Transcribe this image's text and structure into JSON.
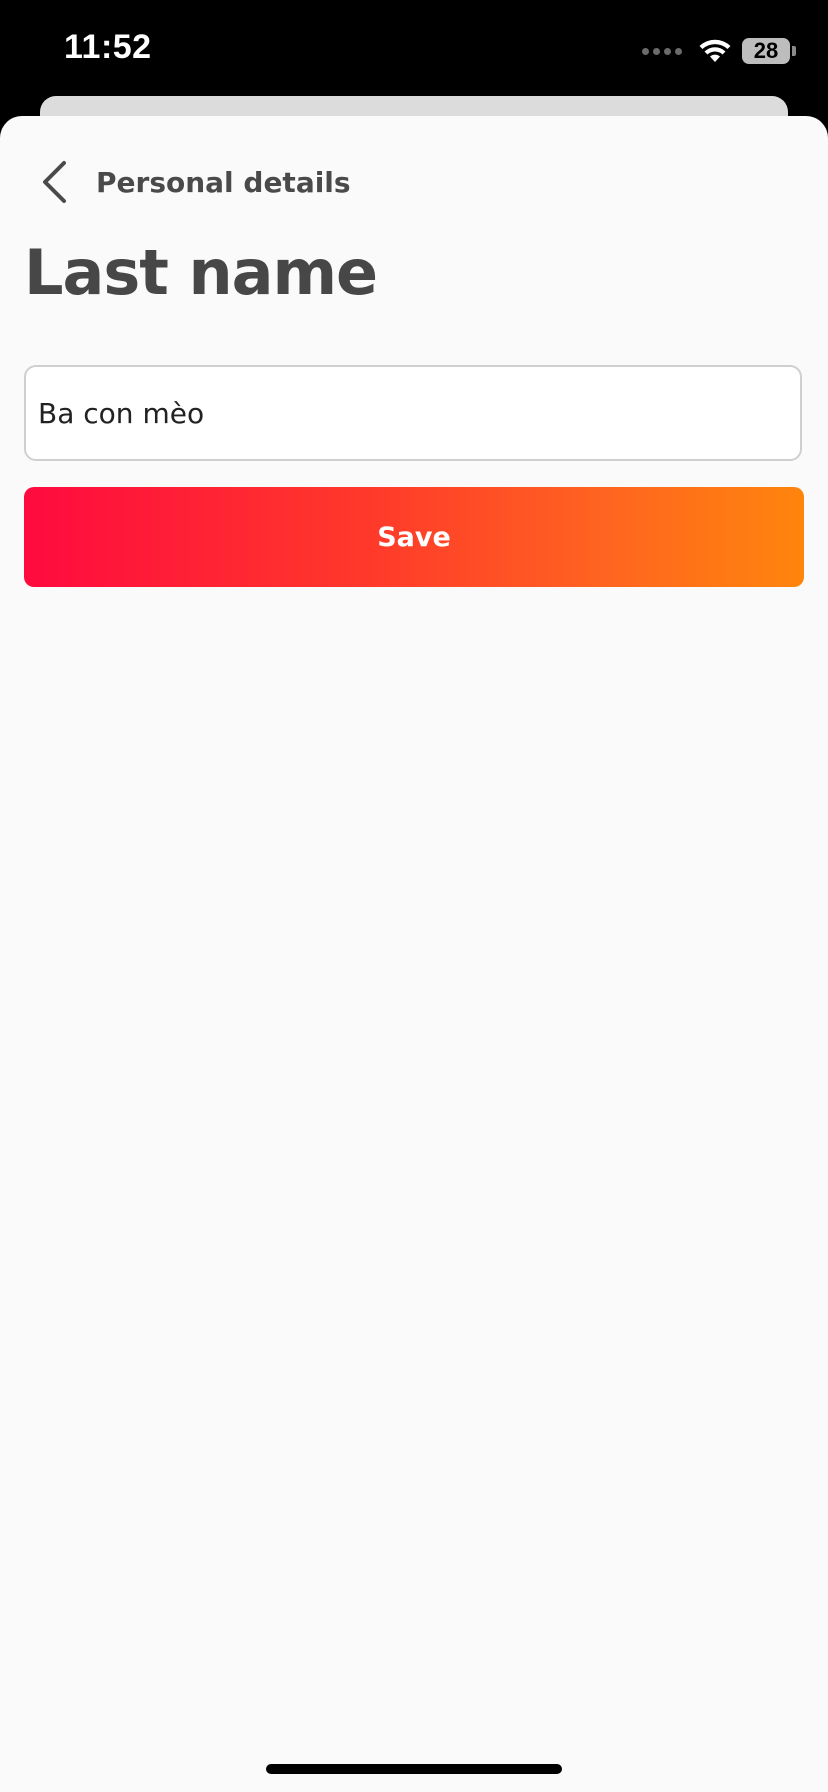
{
  "status_bar": {
    "time": "11:52",
    "battery_level": "28"
  },
  "nav": {
    "back_label": "Personal details"
  },
  "page": {
    "title": "Last name"
  },
  "form": {
    "last_name_value": "Ba con mèo"
  },
  "actions": {
    "save_label": "Save"
  },
  "colors": {
    "accent_start": "#ff0a3f",
    "accent_end": "#ff850c",
    "text_primary": "#474747",
    "background": "#fafafa"
  },
  "icons": {
    "back": "chevron-left-icon",
    "wifi": "wifi-icon",
    "battery": "battery-icon",
    "signal": "signal-icon"
  }
}
